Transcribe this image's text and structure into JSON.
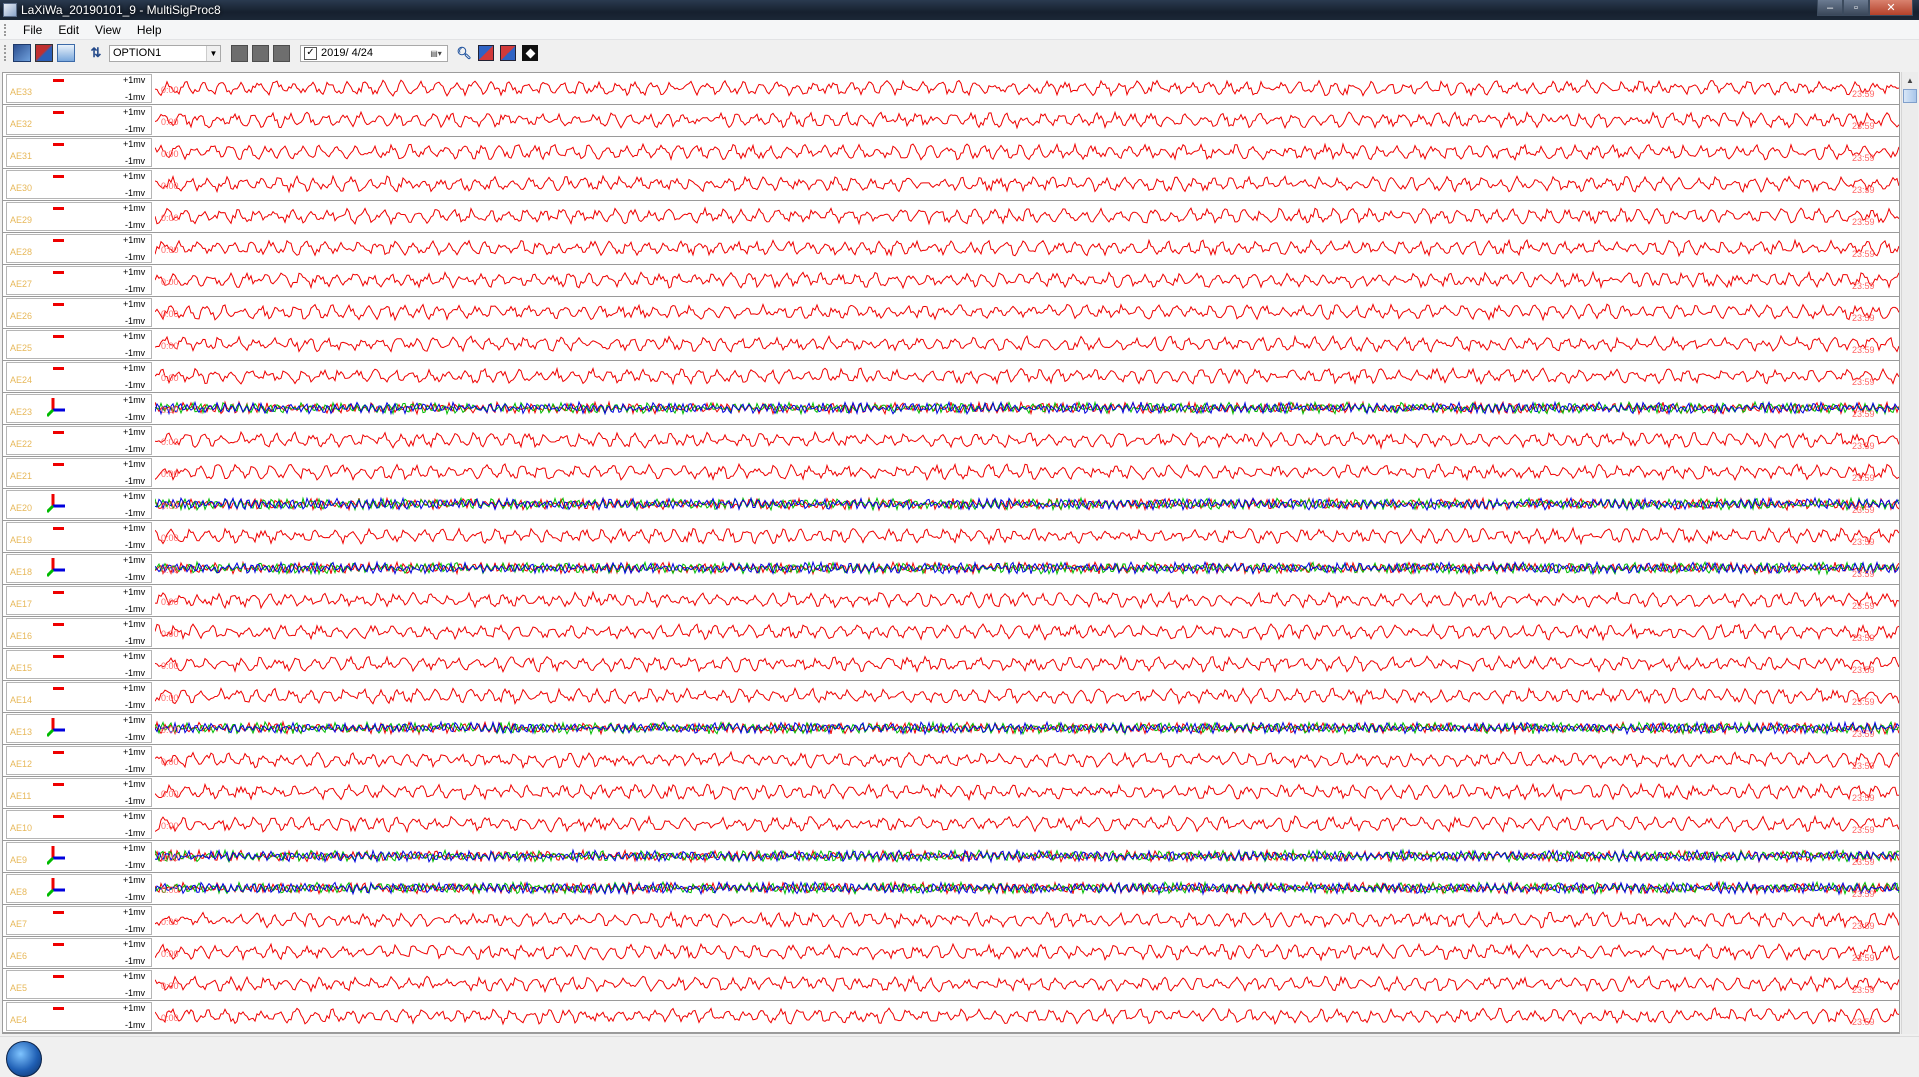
{
  "window": {
    "title": "LaXiWa_20190101_9 - MultiSigProc8",
    "controls": [
      "minimize",
      "maximize",
      "close"
    ]
  },
  "menu": [
    "File",
    "Edit",
    "View",
    "Help"
  ],
  "toolbar": {
    "option_value": "OPTION1",
    "date_checked": true,
    "date_value": "2019/  4/24",
    "icons": [
      "open-icon",
      "save-icon",
      "reload-icon",
      "sort-icon",
      "gray-block-icon",
      "gray-block-icon",
      "gray-block-icon",
      "calendar-icon",
      "zoom-icon",
      "channel-red-icon",
      "channel-blue-icon",
      "diamond-icon"
    ]
  },
  "scale": {
    "plus": "+1mv",
    "minus": "-1mv"
  },
  "time": {
    "start": "0:00",
    "end": "23:59"
  },
  "colors": {
    "single": "#ee0000",
    "x_axis": "#0000dd",
    "y_axis": "#00bb00",
    "z_axis": "#ee0000"
  },
  "channels": [
    {
      "name": "AE33",
      "type": "single"
    },
    {
      "name": "AE32",
      "type": "single"
    },
    {
      "name": "AE31",
      "type": "single"
    },
    {
      "name": "AE30",
      "type": "single"
    },
    {
      "name": "AE29",
      "type": "single"
    },
    {
      "name": "AE28",
      "type": "single"
    },
    {
      "name": "AE27",
      "type": "single"
    },
    {
      "name": "AE26",
      "type": "single"
    },
    {
      "name": "AE25",
      "type": "single"
    },
    {
      "name": "AE24",
      "type": "single"
    },
    {
      "name": "AE23",
      "type": "triaxial"
    },
    {
      "name": "AE22",
      "type": "single"
    },
    {
      "name": "AE21",
      "type": "single"
    },
    {
      "name": "AE20",
      "type": "triaxial"
    },
    {
      "name": "AE19",
      "type": "single"
    },
    {
      "name": "AE18",
      "type": "triaxial"
    },
    {
      "name": "AE17",
      "type": "single"
    },
    {
      "name": "AE16",
      "type": "single"
    },
    {
      "name": "AE15",
      "type": "single"
    },
    {
      "name": "AE14",
      "type": "single"
    },
    {
      "name": "AE13",
      "type": "triaxial"
    },
    {
      "name": "AE12",
      "type": "single"
    },
    {
      "name": "AE11",
      "type": "single"
    },
    {
      "name": "AE10",
      "type": "single"
    },
    {
      "name": "AE9",
      "type": "triaxial"
    },
    {
      "name": "AE8",
      "type": "triaxial"
    },
    {
      "name": "AE7",
      "type": "single"
    },
    {
      "name": "AE6",
      "type": "single"
    },
    {
      "name": "AE5",
      "type": "single"
    },
    {
      "name": "AE4",
      "type": "single"
    }
  ]
}
